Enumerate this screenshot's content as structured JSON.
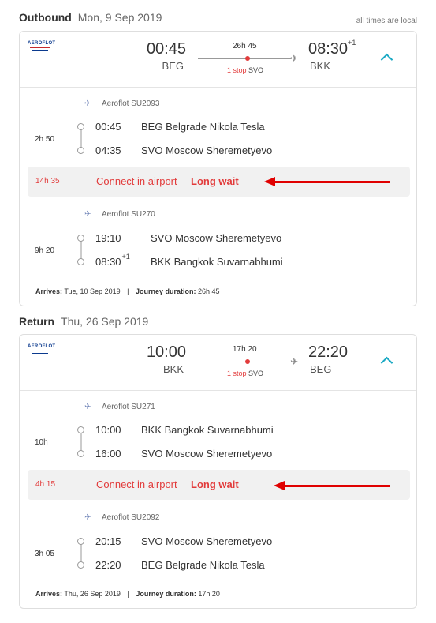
{
  "note": "all times are local",
  "outbound": {
    "label": "Outbound",
    "date": "Mon, 9 Sep 2019",
    "summary": {
      "dep_time": "00:45",
      "dep_code": "BEG",
      "duration": "26h 45",
      "stop_count": "1 stop",
      "stop_code": "SVO",
      "arr_time": "08:30",
      "arr_plus": "+1",
      "arr_code": "BKK"
    },
    "segments": [
      {
        "airline": "Aeroflot SU2093",
        "duration": "2h 50",
        "dep_time": "00:45",
        "dep_place": "BEG Belgrade Nikola Tesla",
        "arr_time": "04:35",
        "arr_place": "SVO Moscow Sheremetyevo"
      },
      {
        "airline": "Aeroflot SU270",
        "duration": "9h 20",
        "dep_time": "19:10",
        "dep_place": "SVO Moscow Sheremetyevo",
        "arr_time": "08:30",
        "arr_plus": "+1",
        "arr_place": "BKK Bangkok Suvarnabhumi"
      }
    ],
    "layover": {
      "duration": "14h 35",
      "connect": "Connect in airport",
      "wait": "Long wait"
    },
    "footer": {
      "arrives_label": "Arrives:",
      "arrives": "Tue, 10 Sep 2019",
      "journey_label": "Journey duration:",
      "journey": "26h 45"
    }
  },
  "return": {
    "label": "Return",
    "date": "Thu, 26 Sep 2019",
    "summary": {
      "dep_time": "10:00",
      "dep_code": "BKK",
      "duration": "17h 20",
      "stop_count": "1 stop",
      "stop_code": "SVO",
      "arr_time": "22:20",
      "arr_code": "BEG"
    },
    "segments": [
      {
        "airline": "Aeroflot SU271",
        "duration": "10h",
        "dep_time": "10:00",
        "dep_place": "BKK Bangkok Suvarnabhumi",
        "arr_time": "16:00",
        "arr_place": "SVO Moscow Sheremetyevo"
      },
      {
        "airline": "Aeroflot SU2092",
        "duration": "3h 05",
        "dep_time": "20:15",
        "dep_place": "SVO Moscow Sheremetyevo",
        "arr_time": "22:20",
        "arr_place": "BEG Belgrade Nikola Tesla"
      }
    ],
    "layover": {
      "duration": "4h 15",
      "connect": "Connect in airport",
      "wait": "Long wait"
    },
    "footer": {
      "arrives_label": "Arrives:",
      "arrives": "Thu, 26 Sep 2019",
      "journey_label": "Journey duration:",
      "journey": "17h 20"
    }
  },
  "airline_logo_text": "AEROFLOT",
  "icons": {
    "plane": "plane-icon",
    "expand": "chevron-up-icon",
    "airline": "aeroflot-logo"
  },
  "colors": {
    "accent": "#1aa9c4",
    "alert": "#e23b3b",
    "annotation_arrow": "#e00000"
  }
}
